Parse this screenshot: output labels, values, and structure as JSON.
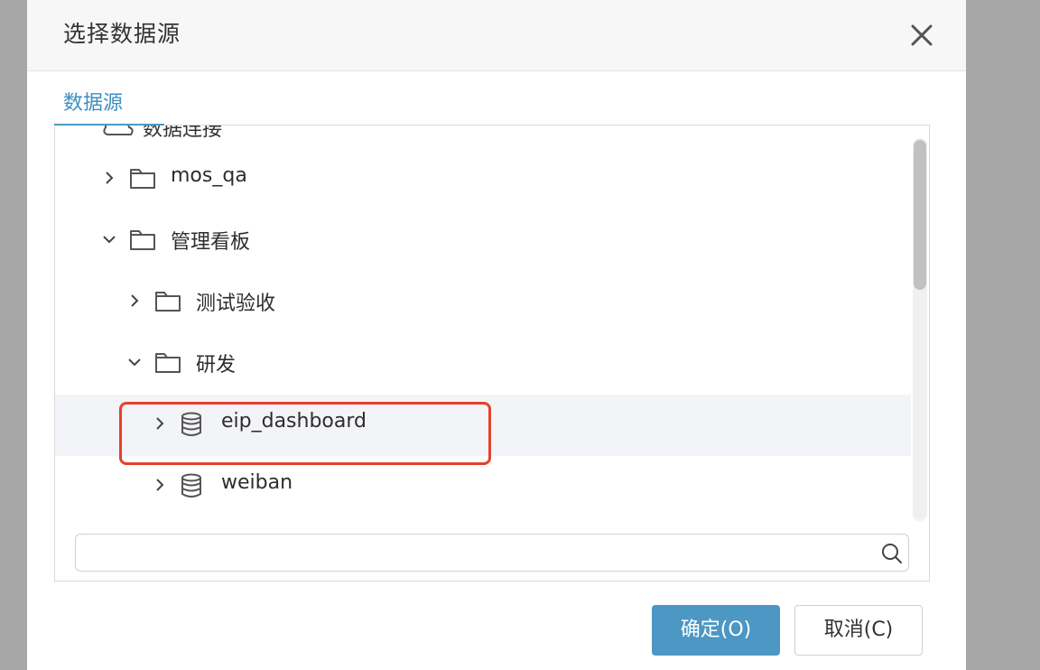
{
  "dialog": {
    "title": "选择数据源",
    "tab_label": "数据源",
    "partial_row_label": "数据连接",
    "tree": [
      {
        "label": "mos_qa",
        "icon": "folder-icon",
        "expanded": false,
        "depth": 1,
        "selected": false
      },
      {
        "label": "管理看板",
        "icon": "folder-icon",
        "expanded": true,
        "depth": 1,
        "selected": false
      },
      {
        "label": "测试验收",
        "icon": "folder-icon",
        "expanded": false,
        "depth": 2,
        "selected": false
      },
      {
        "label": "研发",
        "icon": "folder-icon",
        "expanded": true,
        "depth": 2,
        "selected": false
      },
      {
        "label": "eip_dashboard",
        "icon": "database-icon",
        "expanded": false,
        "depth": 3,
        "selected": true
      },
      {
        "label": "weiban",
        "icon": "database-icon",
        "expanded": false,
        "depth": 3,
        "selected": false
      }
    ],
    "search": {
      "value": "",
      "placeholder": ""
    },
    "ok_label": "确定(O)",
    "cancel_label": "取消(C)"
  },
  "colors": {
    "accent": "#4c97c3",
    "highlight": "#e5412d",
    "selected_row": "#f3f4f7",
    "overlay": "#a7a7a7"
  }
}
